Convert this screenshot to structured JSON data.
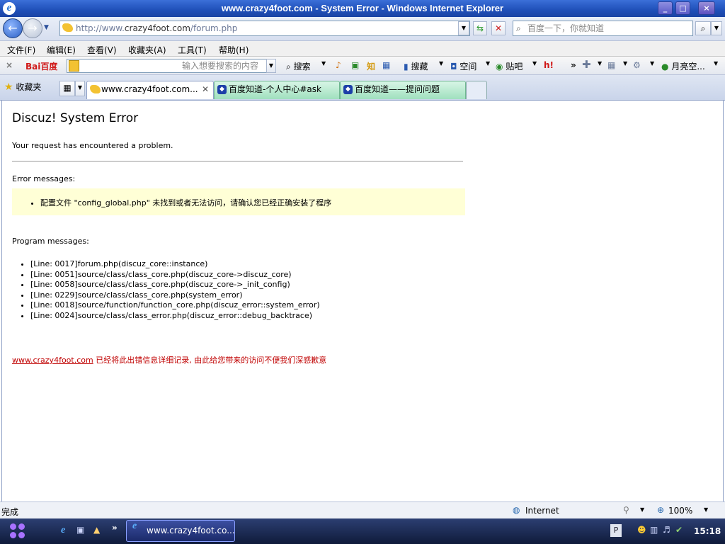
{
  "window": {
    "title": "www.crazy4foot.com - System Error - Windows Internet Explorer",
    "ie_glyph": "e"
  },
  "address": {
    "url_prefix": "http://www.",
    "url_host": "crazy4foot.com",
    "url_path": "/forum.php",
    "search_placeholder": "百度一下，你就知道"
  },
  "menu": [
    "文件(F)",
    "编辑(E)",
    "查看(V)",
    "收藏夹(A)",
    "工具(T)",
    "帮助(H)"
  ],
  "toolbar": {
    "baidu_logo": "Bai百度",
    "search_placeholder": "输入想要搜索的内容",
    "search": "搜索",
    "zhi": "知",
    "souchang": "搜藏",
    "kongjian": "空间",
    "tieba": "贴吧",
    "user": "月亮空..."
  },
  "tabs": {
    "favorites": "收藏夹",
    "items": [
      {
        "label": "www.crazy4foot.com..."
      },
      {
        "label": "百度知道-个人中心#ask"
      },
      {
        "label": "百度知道——提问问题"
      }
    ]
  },
  "page": {
    "heading": "Discuz! System Error",
    "intro": "Your request has encountered a problem.",
    "error_label": "Error messages:",
    "error_item": "配置文件 \"config_global.php\" 未找到或者无法访问，请确认您已经正确安装了程序",
    "program_label": "Program messages:",
    "program_items": [
      "[Line: 0017]forum.php(discuz_core::instance)",
      "[Line: 0051]source/class/class_core.php(discuz_core->discuz_core)",
      "[Line: 0058]source/class/class_core.php(discuz_core->_init_config)",
      "[Line: 0229]source/class/class_core.php(system_error)",
      "[Line: 0018]source/function/function_core.php(discuz_error::system_error)",
      "[Line: 0024]source/class/class_error.php(discuz_error::debug_backtrace)"
    ],
    "footer_link": "www.crazy4foot.com",
    "footer_text": " 已经将此出错信息详细记录, 由此给您带来的访问不便我们深感歉意"
  },
  "status": {
    "text": "完成",
    "zone": "Internet",
    "zoom": "100%"
  },
  "taskbar": {
    "active_window": "www.crazy4foot.co...",
    "clock": "15:18"
  },
  "colors": {
    "error_box_bg": "#ffffd6",
    "footer_red": "#c00000",
    "titlebar_blue": "#1f4fb8"
  }
}
